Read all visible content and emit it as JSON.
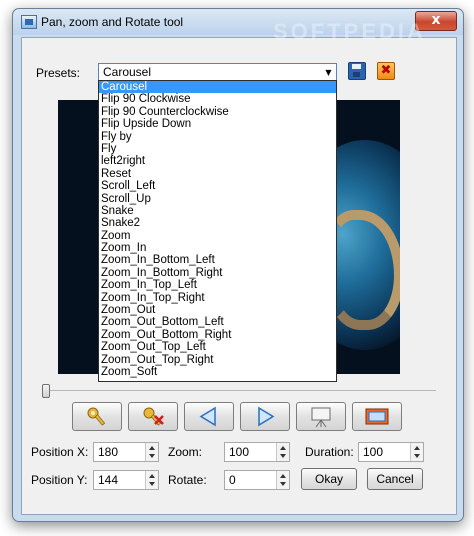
{
  "window": {
    "title": "Pan, zoom and Rotate tool",
    "close_glyph": "x",
    "icon": "app-icon"
  },
  "presets": {
    "label": "Presets:",
    "selected": "Carousel",
    "options": [
      "Carousel",
      "Flip 90 Clockwise",
      "Flip 90 Counterclockwise",
      "Flip Upside Down",
      "Fly by",
      "Fly",
      "left2right",
      "Reset",
      "Scroll_Left",
      "Scroll_Up",
      "Snake",
      "Snake2",
      "Zoom",
      "Zoom_In",
      "Zoom_In_Bottom_Left",
      "Zoom_In_Bottom_Right",
      "Zoom_In_Top_Left",
      "Zoom_In_Top_Right",
      "Zoom_Out",
      "Zoom_Out_Bottom_Left",
      "Zoom_Out_Bottom_Right",
      "Zoom_Out_Top_Left",
      "Zoom_Out_Top_Right",
      "Zoom_Soft"
    ],
    "save_icon": "save-icon",
    "delete_icon": "delete-icon"
  },
  "toolbar": {
    "buttons": [
      "key-icon",
      "remove-key-icon",
      "previous-icon",
      "next-icon",
      "preview-icon",
      "frame-icon"
    ]
  },
  "fields": {
    "position_x": {
      "label": "Position X:",
      "value": "180"
    },
    "position_y": {
      "label": "Position Y:",
      "value": "144"
    },
    "zoom": {
      "label": "Zoom:",
      "value": "100"
    },
    "rotate": {
      "label": "Rotate:",
      "value": "0"
    },
    "duration": {
      "label": "Duration:",
      "value": "100"
    }
  },
  "buttons": {
    "okay": "Okay",
    "cancel": "Cancel"
  },
  "watermark": "SOFTPEDIA",
  "colors": {
    "selection": "#3399ff",
    "window_frame": "#c9dcef"
  }
}
